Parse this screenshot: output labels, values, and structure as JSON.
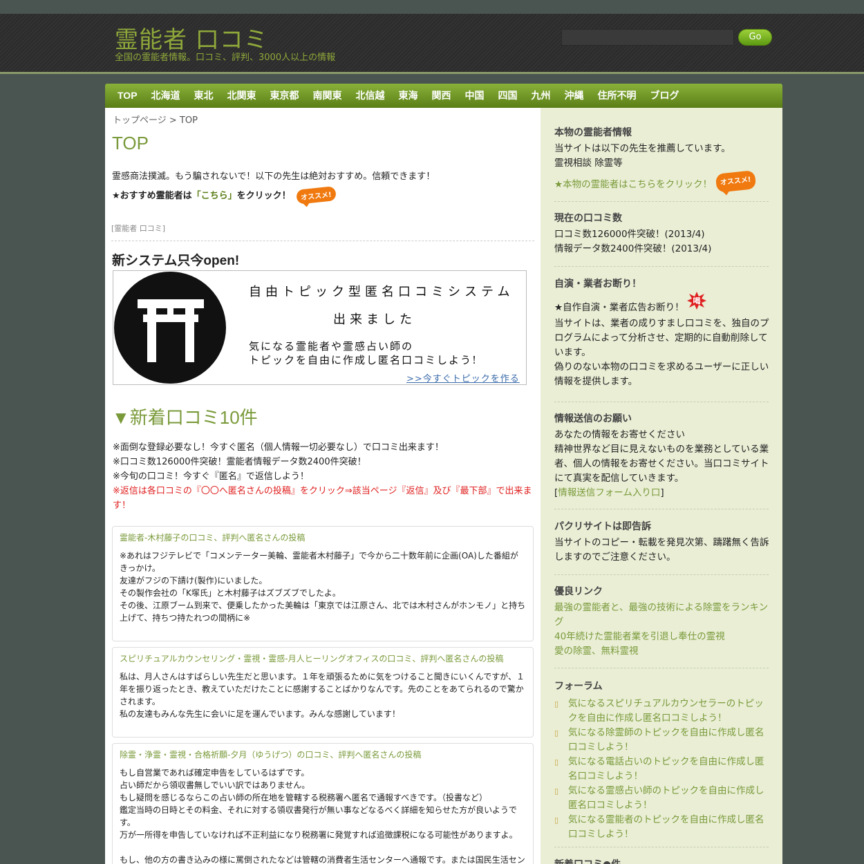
{
  "header": {
    "site_title": "霊能者 口コミ",
    "tagline": "全国の霊能者情報。口コミ、評判、3000人以上の情報",
    "search_placeholder": "",
    "search_button": "Go"
  },
  "nav": {
    "items": [
      "TOP",
      "北海道",
      "東北",
      "北関東",
      "東京都",
      "南関東",
      "北信越",
      "東海",
      "関西",
      "中国",
      "四国",
      "九州",
      "沖縄",
      "住所不明",
      "ブログ"
    ]
  },
  "main": {
    "breadcrumb_home": "トップページ",
    "breadcrumb_sep": " > ",
    "breadcrumb_current": "TOP",
    "page_title": "TOP",
    "intro": "霊感商法撲滅。もう騙されないで！以下の先生は絶対おすすめ。信頼できます！",
    "intro_link_prefix": "★おすすめ霊能者は",
    "intro_link_text": "「こちら」",
    "intro_link_suffix": "をクリック！",
    "badge": "オススメ!",
    "tag": "[霊能者 口コミ]",
    "new_system": "新システム只今open!",
    "banner": {
      "line1": "自由トピック型匿名口コミシステム",
      "line2": "出来ました",
      "line3": "気になる霊能者や霊感占い師の",
      "line4": "トピックを自由に作成し匿名口コミしよう!",
      "link": ">>今すぐトピックを作る"
    },
    "new_reviews_title": "▼新着口コミ10件",
    "notes": [
      "※面倒な登録必要なし！今すぐ匿名（個人情報一切必要なし）で口コミ出来ます！",
      "※口コミ数126000件突破！霊能者情報データ数2400件突破！",
      "※今旬の口コミ！今すぐ『匿名』で返信しよう！"
    ],
    "note_red": "※返信は各口コミの『〇〇へ匿名さんの投稿』をクリック⇒該当ページ『返信』及び『最下部』で出来ます！",
    "reviews": [
      {
        "title": "霊能者-木村藤子の口コミ、評判へ匿名さんの投稿",
        "body": "※あれはフジテレビで「コメンテーター美輪、霊能者木村藤子」で今から二十数年前に企画(OA)した番組がきっかけ。\n友達がフジの下請け(製作)にいました。\nその製作会社の「K塚氏」と木村藤子はズブズブでしたよ。\nその後、江原ブーム到来で、便乗したかった美輪は「東京では江原さん、北では木村さんがホンモノ」と持ち上げて、持ちつ持たれつの間柄に※"
      },
      {
        "title": "スピリチュアルカウンセリング・霊視・霊感-月人ヒーリングオフィスの口コミ、評判へ匿名さんの投稿",
        "body": "私は、月人さんはすばらしい先生だと思います。１年を頑張るために気をつけること聞きにいくんですが、１年を振り返ったとき、教えていただけたことに感謝することばかりなんです。先のことをあてられるので驚かされます。\n私の友達もみんな先生に会いに足を運んでいます。みんな感謝しています！"
      },
      {
        "title": "除霊・浄霊・霊視・合格祈願-夕月（ゆうげつ）の口コミ、評判へ匿名さんの投稿",
        "body": "もし自営業であれば確定申告をしているはずです。\n占い師だから領収書無しでいい訳ではありません。\nもし疑問を感じるならこの占い師の所在地を管轄する税務署へ匿名で通報すべきです。（投書など）\n鑑定当時の日時とその料金、それに対する領収書発行が無い事などなるべく詳細を知らせた方が良いようです。\n万が一所得を申告していなければ不正利益になり税務署に発覚すれば追徴課税になる可能性がありますよ。\n\nもし、他の方の書き込みの様に罵倒されたなどは管轄の消費者生活センターへ通報です。または国民生活セン"
      }
    ]
  },
  "sidebar": {
    "w1_title": "本物の霊能者情報",
    "w1_line1": "当サイトは以下の先生を推薦しています。",
    "w1_line2": "霊視相談 除霊等",
    "w1_link": "★本物の霊能者はこちらをクリック！",
    "w1_badge": "オススメ!",
    "w2_title": "現在の口コミ数",
    "w2_line1": "口コミ数126000件突破！(2013/4)",
    "w2_line2": "情報データ数2400件突破！(2013/4)",
    "w3_title": "自演・業者お断り！",
    "w3_line1": "★自作自演・業者広告お断り！",
    "w3_badge": "喝",
    "w3_body": "当サイトは、業者の成りすまし口コミを、独自のプログラムによって分析させ、定期的に自動削除しています。\n偽りのない本物の口コミを求めるユーザーに正しい情報を提供します。",
    "w4_title": "情報送信のお願い",
    "w4_body": "あなたの情報をお寄せください\n精神世界など目に見えないものを業務としている業者、個人の情報をお寄せください。当口コミサイトにて真実を配信していきます。",
    "w4_link_prefix": "[",
    "w4_link": "情報送信フォーム入り口",
    "w4_link_suffix": "]",
    "w5_title": "パクリサイトは即告訴",
    "w5_body": "当サイトのコピー・転載を発見次第、躊躇無く告訴しますのでご注意ください。",
    "w6_title": "優良リンク",
    "w6_links": [
      "最強の霊能者と、最強の技術による除霊をランキング",
      "40年続けた霊能者業を引退し奉仕の霊視",
      "愛の除霊、無料霊視"
    ],
    "w7_title": "フォーラム",
    "w7_items": [
      "気になるスピリチュアルカウンセラーのトピックを自由に作成し匿名口コミしよう！",
      "気になる除霊師のトピックを自由に作成し匿名口コミしよう！",
      "気になる電話占いのトピックを自由に作成し匿名口コミしよう！",
      "気になる霊感占い師のトピックを自由に作成し匿名口コミしよう！",
      "気になる霊能者のトピックを自由に作成し匿名口コミしよう！"
    ],
    "w8_title": "新着口コミ●件"
  },
  "colors": {
    "accent_green": "#7a9a3a",
    "nav_green": "#6f9826",
    "sidebar_bg": "#e9eed5",
    "alert_red": "#e02020",
    "badge_orange": "#f07a10"
  }
}
